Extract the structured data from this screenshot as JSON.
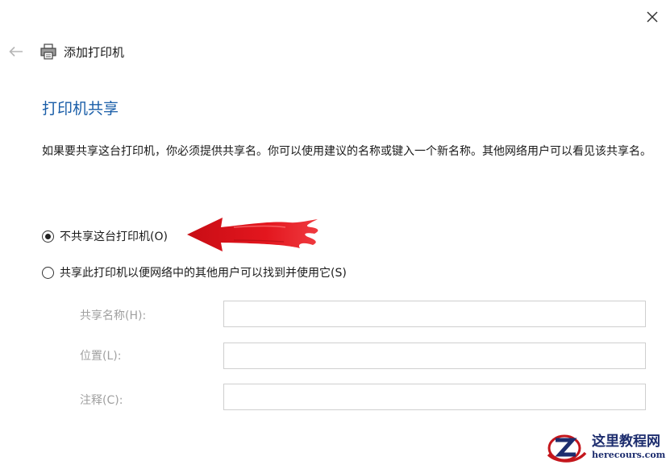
{
  "window": {
    "title": "添加打印机",
    "close_icon": "close-icon",
    "back_icon": "back-arrow-icon",
    "title_icon": "printer-icon"
  },
  "page": {
    "heading": "打印机共享",
    "description": "如果要共享这台打印机，你必须提供共享名。你可以使用建议的名称或键入一个新名称。其他网络用户可以看见该共享名。"
  },
  "options": {
    "no_share": {
      "label": "不共享这台打印机(O)",
      "selected": true
    },
    "share": {
      "label": "共享此打印机以便网络中的其他用户可以找到并使用它(S)",
      "selected": false
    }
  },
  "fields": {
    "share_name": {
      "label": "共享名称(H):",
      "value": ""
    },
    "location": {
      "label": "位置(L):",
      "value": ""
    },
    "comment": {
      "label": "注释(C):",
      "value": ""
    }
  },
  "watermark": {
    "name": "这里教程网",
    "url": "herecours.com"
  },
  "colors": {
    "heading": "#1a5ea8",
    "disabled_text": "#a0a0a0",
    "arrow": "#d8121a",
    "watermark": "#1d2d6e"
  }
}
